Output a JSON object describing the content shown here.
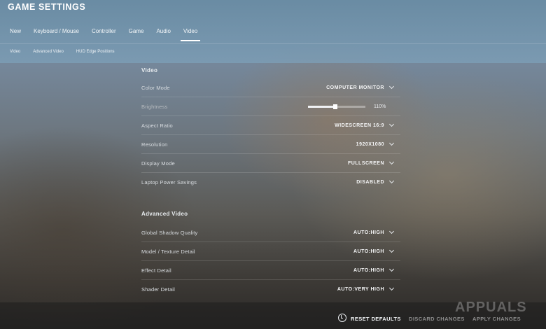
{
  "window": {
    "title": "GAME SETTINGS"
  },
  "tabs": [
    {
      "label": "New"
    },
    {
      "label": "Keyboard / Mouse"
    },
    {
      "label": "Controller"
    },
    {
      "label": "Game"
    },
    {
      "label": "Audio"
    },
    {
      "label": "Video",
      "active": true
    }
  ],
  "subtabs": [
    {
      "label": "Video"
    },
    {
      "label": "Advanced Video"
    },
    {
      "label": "HUD Edge Positions"
    }
  ],
  "video": {
    "title": "Video",
    "rows": [
      {
        "label": "Color Mode",
        "value": "COMPUTER MONITOR"
      },
      {
        "label": "Brightness",
        "value": "110%",
        "fraction": 0.47
      },
      {
        "label": "Aspect Ratio",
        "value": "WIDESCREEN 16:9"
      },
      {
        "label": "Resolution",
        "value": "1920X1080"
      },
      {
        "label": "Display Mode",
        "value": "FULLSCREEN"
      },
      {
        "label": "Laptop Power Savings",
        "value": "DISABLED"
      }
    ]
  },
  "advanced": {
    "title": "Advanced Video",
    "rows": [
      {
        "label": "Global Shadow Quality",
        "value": "AUTO:HIGH"
      },
      {
        "label": "Model / Texture Detail",
        "value": "AUTO:HIGH"
      },
      {
        "label": "Effect Detail",
        "value": "AUTO:HIGH"
      },
      {
        "label": "Shader Detail",
        "value": "AUTO:VERY HIGH"
      }
    ]
  },
  "footer": {
    "reset_label": "RESET DEFAULTS",
    "discard_label": "DISCARD CHANGES",
    "apply_label": "APPLY CHANGES"
  },
  "watermark": "APPUALS",
  "colors": {
    "accent": "#ffffff",
    "topbar": "#7b9fb8",
    "disabled_text": "#8c8c8c"
  }
}
